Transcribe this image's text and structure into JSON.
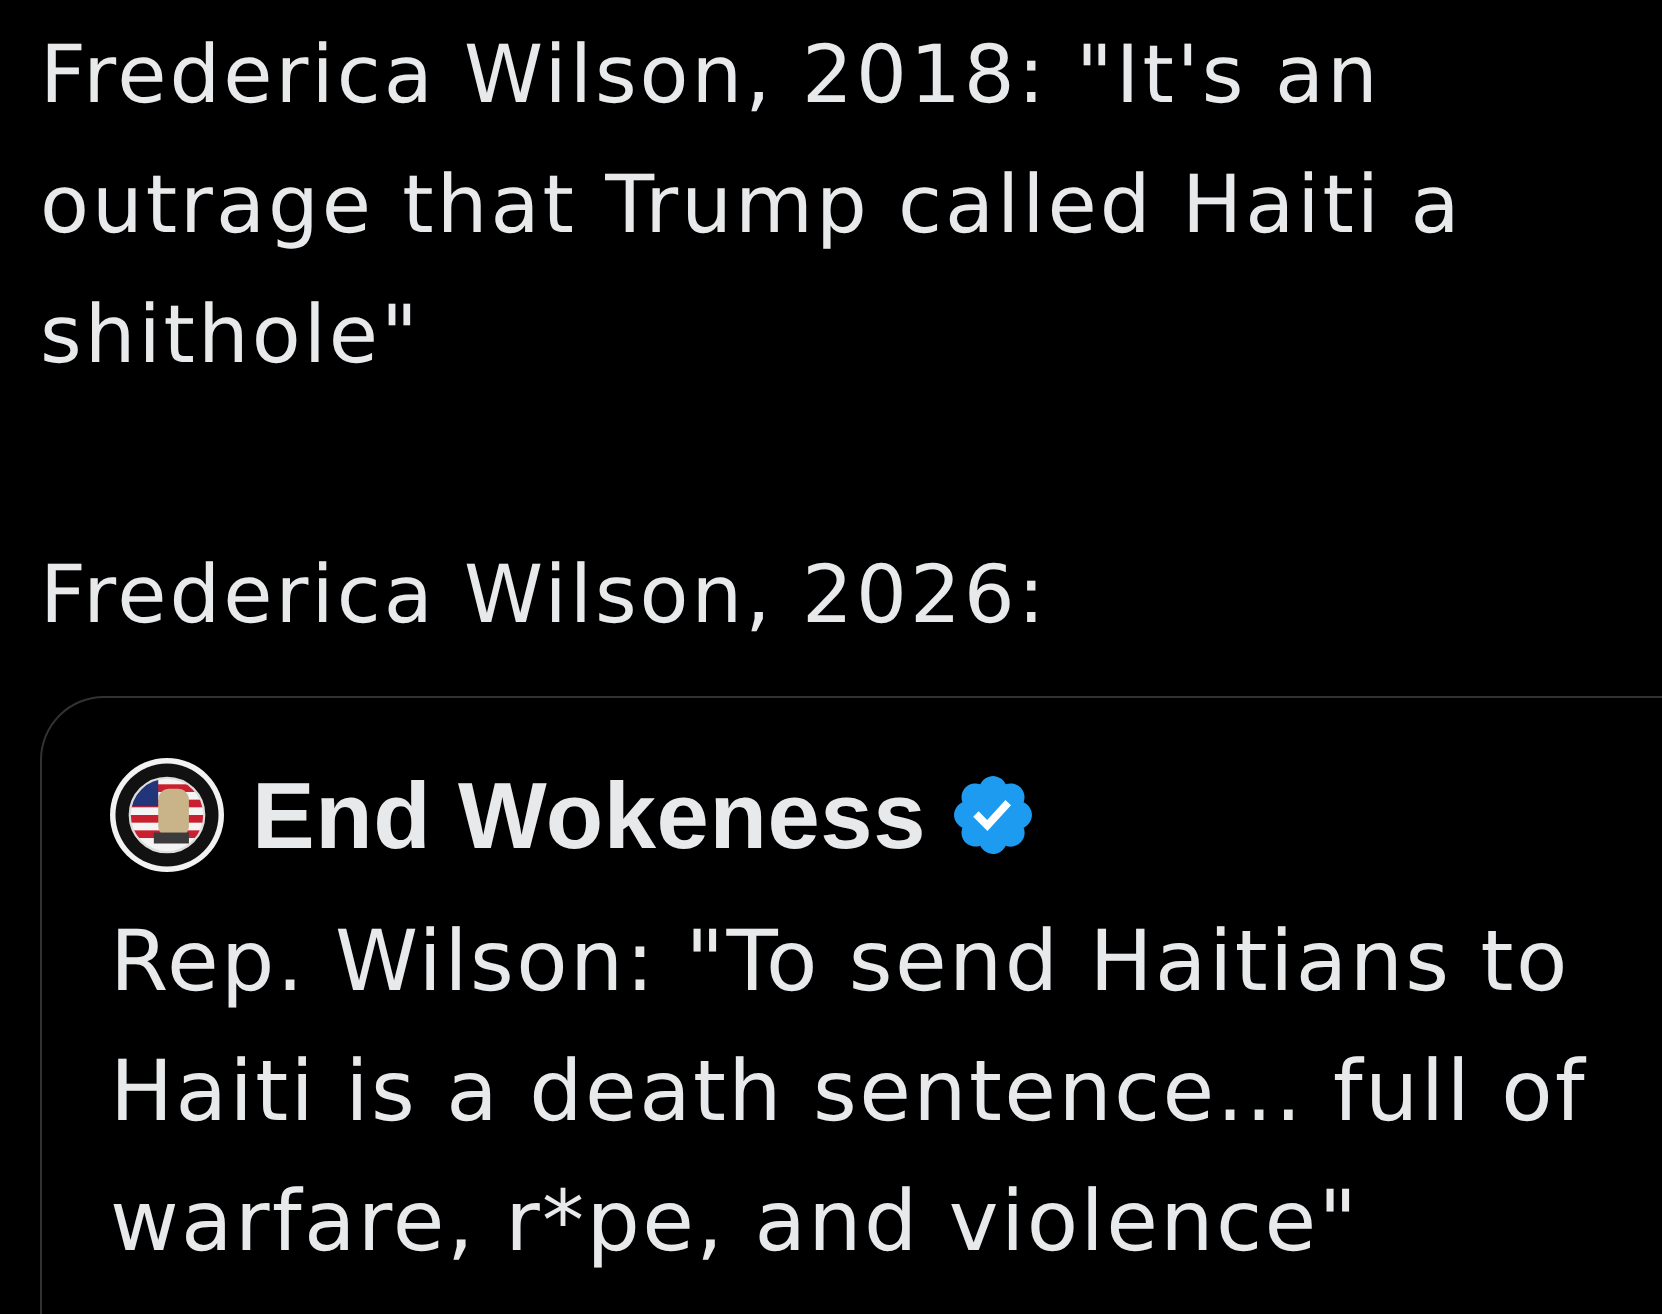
{
  "post": {
    "paragraphs": [
      "Frederica Wilson, 2018: \"It's an outrage that Trump called Haiti a shithole\"",
      "Frederica Wilson, 2026:"
    ]
  },
  "quoted_post": {
    "author": {
      "name": "End Wokeness",
      "verified": true
    },
    "text": "Rep. Wilson: \"To send Haitians to Haiti is a death sentence... full of warfare, r*pe, and violence\""
  }
}
